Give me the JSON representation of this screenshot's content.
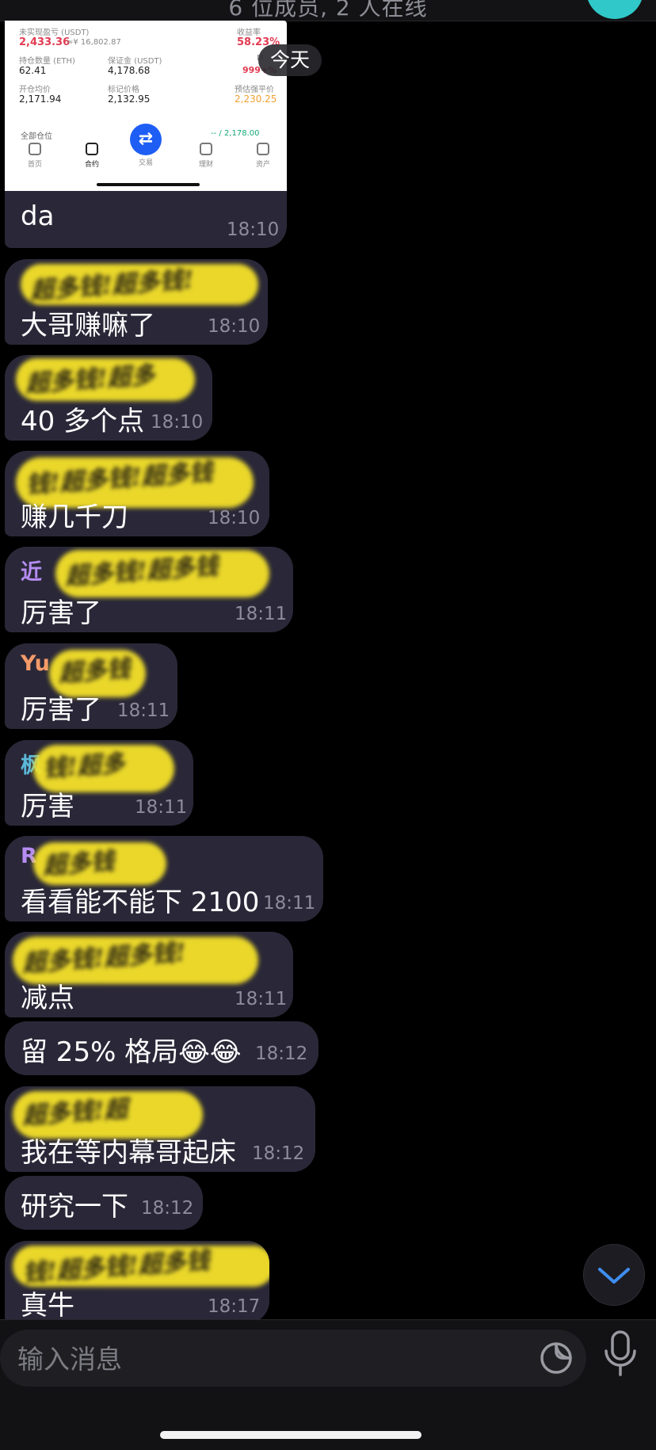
{
  "header": {
    "subtitle": "6 位成员, 2 人在线"
  },
  "date_divider": "今天",
  "screenshot": {
    "unrealized_label": "未实现盈亏 (USDT)",
    "unrealized_value": "2,433.36",
    "unrealized_sub": "≈¥ 16,802.87",
    "yield_label": "收益率",
    "yield_value": "58.23%",
    "position_label": "持仓数量 (ETH)",
    "position_value": "62.41",
    "margin_label": "保证金 (USDT)",
    "margin_value": "4,178.68",
    "mr_label": "M",
    "mr_value": "999+%",
    "open_price_label": "开仓均价",
    "open_price_value": "2,171.94",
    "mark_price_label": "标记价格",
    "mark_price_value": "2,132.95",
    "liq_price_label": "预估强平价",
    "liq_price_value": "2,230.25",
    "overflow_left": "全部仓位",
    "overflow_right": "-- / 2,178.00",
    "nav": [
      "首页",
      "合约",
      "交易",
      "理财",
      "资产"
    ]
  },
  "messages": [
    {
      "text": "da",
      "time": "18:10"
    },
    {
      "sender": "",
      "text": "大哥赚嘛了",
      "time": "18:10",
      "scribble": "超多钱!超多钱!"
    },
    {
      "sender": "",
      "text": "40 多个点",
      "time": "18:10",
      "scribble": "超多钱!超多"
    },
    {
      "sender": "",
      "text": "赚几千刀",
      "time": "18:10",
      "scribble": "钱!超多钱!超多钱"
    },
    {
      "sender": "近",
      "text": "厉害了",
      "time": "18:11",
      "scribble": "超多钱!超多钱"
    },
    {
      "sender": "Yu",
      "text": "厉害了",
      "time": "18:11",
      "scribble": "超多钱"
    },
    {
      "sender": "枫",
      "text": "厉害",
      "time": "18:11",
      "scribble": "钱!超多"
    },
    {
      "sender": "R",
      "text": "看看能不能下 2100",
      "time": "18:11",
      "scribble": "超多钱"
    },
    {
      "sender": "",
      "text": "减点",
      "time": "18:11",
      "scribble": "超多钱!超多钱!"
    },
    {
      "text": "留 25% 格局😂😂",
      "time": "18:12"
    },
    {
      "sender": "",
      "text": "我在等内幕哥起床",
      "time": "18:12",
      "scribble": "超多钱!超"
    },
    {
      "text": "研究一下",
      "time": "18:12"
    },
    {
      "sender": "",
      "text": "真牛",
      "time": "18:17",
      "scribble": "钱!超多钱!超多钱"
    }
  ],
  "input": {
    "placeholder": "输入消息"
  },
  "icons": {
    "sticker": "sticker-icon",
    "mic": "microphone-icon",
    "scroll_down": "chevron-down-icon"
  },
  "colors": {
    "bubble": "#2a2838",
    "scribble": "#f5e12a",
    "sender_purple": "#b58cf2",
    "sender_orange": "#f59a6a",
    "sender_teal": "#5cb8d8",
    "accent_blue": "#3f8ef0"
  }
}
